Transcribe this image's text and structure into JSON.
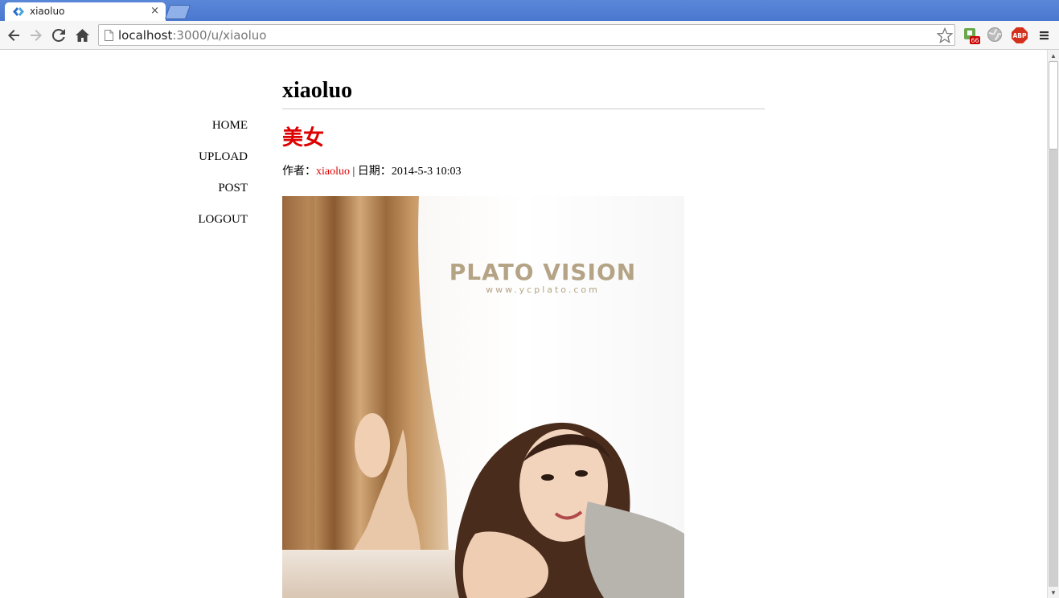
{
  "browser": {
    "tab_title": "xiaoluo",
    "tab_close": "×",
    "url_host": "localhost",
    "url_rest": ":3000/u/xiaoluo",
    "extension_badge": "66",
    "abp_label": "ABP"
  },
  "nav": {
    "items": [
      {
        "label": "HOME"
      },
      {
        "label": "UPLOAD"
      },
      {
        "label": "POST"
      },
      {
        "label": "LOGOUT"
      }
    ]
  },
  "main": {
    "user_title": "xiaoluo",
    "post_title": "美女",
    "meta_author_prefix": "作者：",
    "meta_author": "xiaoluo",
    "meta_date_prefix": " | 日期：",
    "meta_date": "2014-5-3 10:03",
    "photo_logo": "PLATO VISION",
    "photo_sub": "www.ycplato.com"
  },
  "colors": {
    "accent": "#dd0000",
    "chrome": "#4a78cf"
  }
}
